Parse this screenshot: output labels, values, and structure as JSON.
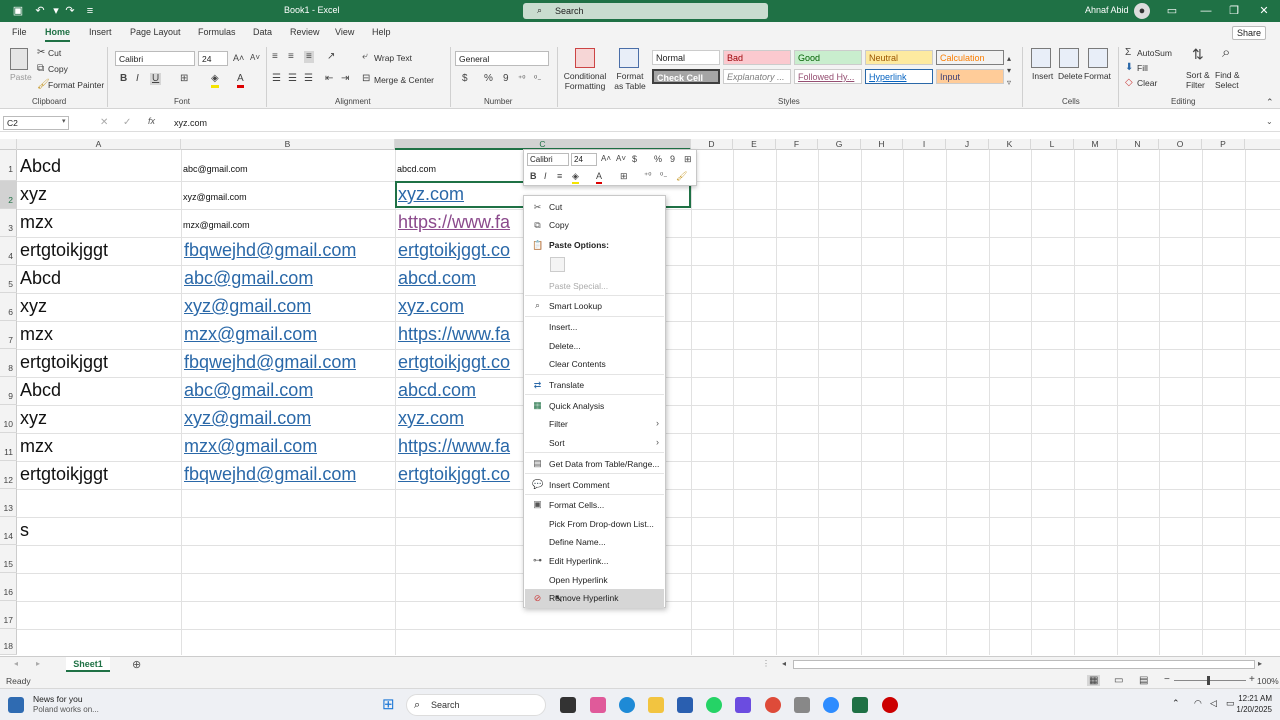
{
  "titlebar": {
    "doc_title": "Book1 - Excel",
    "search": "Search",
    "user": "Ahnaf Abid"
  },
  "tabs": [
    "File",
    "Home",
    "Insert",
    "Page Layout",
    "Formulas",
    "Data",
    "Review",
    "View",
    "Help"
  ],
  "share": "Share",
  "ribbon": {
    "clipboard": {
      "paste": "Paste",
      "cut": "Cut",
      "copy": "Copy",
      "format_painter": "Format Painter",
      "label": "Clipboard"
    },
    "font": {
      "name": "Calibri",
      "size": "24",
      "label": "Font",
      "bold": "B",
      "italic": "I",
      "underline": "U"
    },
    "alignment": {
      "wrap": "Wrap Text",
      "merge": "Merge & Center",
      "label": "Alignment"
    },
    "number": {
      "format": "General",
      "label": "Number",
      "currency": "$",
      "percent": "%",
      "comma": "9"
    },
    "styles": {
      "cond": "Conditional Formatting",
      "fmt_table": "Format as Table",
      "label": "Styles",
      "cells": [
        "Normal",
        "Bad",
        "Good",
        "Neutral",
        "Calculation",
        "Check Cell",
        "Explanatory ...",
        "Followed Hy...",
        "Hyperlink",
        "Input"
      ]
    },
    "cells": {
      "insert": "Insert",
      "delete": "Delete",
      "format": "Format",
      "label": "Cells"
    },
    "editing": {
      "autosum": "AutoSum",
      "fill": "Fill",
      "clear": "Clear",
      "sort": "Sort & Filter",
      "find": "Find & Select",
      "label": "Editing"
    }
  },
  "formula_bar": {
    "name_box": "C2",
    "fx": "fx",
    "content": "xyz.com"
  },
  "columns": [
    "A",
    "B",
    "C",
    "D",
    "E",
    "F",
    "G",
    "H",
    "I",
    "J",
    "K",
    "L",
    "M",
    "N",
    "O",
    "P"
  ],
  "rows": [
    "1",
    "2",
    "3",
    "4",
    "5",
    "6",
    "7",
    "8",
    "9",
    "10",
    "11",
    "12",
    "13",
    "14",
    "15",
    "16",
    "17",
    "18"
  ],
  "cells": {
    "r1": {
      "a": "Abcd",
      "b": "abc@gmail.com",
      "c": "abcd.com"
    },
    "r2": {
      "a": "xyz",
      "b": "xyz@gmail.com",
      "c": "xyz.com"
    },
    "r3": {
      "a": "mzx",
      "b": "mzx@gmail.com",
      "c": "https://www.fa"
    },
    "r4": {
      "a": "ertgtoikjggt",
      "b": "fbqwejhd@gmail.com",
      "c": "ertgtoikjggt.co"
    },
    "r5": {
      "a": "Abcd",
      "b": "abc@gmail.com",
      "c": "abcd.com"
    },
    "r6": {
      "a": "xyz",
      "b": "xyz@gmail.com",
      "c": "xyz.com"
    },
    "r7": {
      "a": "mzx",
      "b": "mzx@gmail.com",
      "c": "https://www.fa"
    },
    "r8": {
      "a": "ertgtoikjggt",
      "b": "fbqwejhd@gmail.com",
      "c": "ertgtoikjggt.co"
    },
    "r9": {
      "a": "Abcd",
      "b": "abc@gmail.com",
      "c": "abcd.com"
    },
    "r10": {
      "a": "xyz",
      "b": "xyz@gmail.com",
      "c": "xyz.com"
    },
    "r11": {
      "a": "mzx",
      "b": "mzx@gmail.com",
      "c": "https://www.fa"
    },
    "r12": {
      "a": "ertgtoikjggt",
      "b": "fbqwejhd@gmail.com",
      "c": "ertgtoikjggt.co"
    },
    "r14": {
      "a": "s"
    }
  },
  "mini_toolbar": {
    "font": "Calibri",
    "size": "24"
  },
  "context_menu": {
    "cut": "Cut",
    "copy": "Copy",
    "paste_options": "Paste Options:",
    "paste_special": "Paste Special...",
    "smart_lookup": "Smart Lookup",
    "insert": "Insert...",
    "delete": "Delete...",
    "clear": "Clear Contents",
    "translate": "Translate",
    "quick_analysis": "Quick Analysis",
    "filter": "Filter",
    "sort": "Sort",
    "get_data": "Get Data from Table/Range...",
    "insert_comment": "Insert Comment",
    "format_cells": "Format Cells...",
    "pick_list": "Pick From Drop-down List...",
    "define_name": "Define Name...",
    "edit_link": "Edit Hyperlink...",
    "open_link": "Open Hyperlink",
    "remove_link": "Remove Hyperlink"
  },
  "sheet_tab": "Sheet1",
  "status": {
    "ready": "Ready",
    "zoom": "100%"
  },
  "taskbar": {
    "news_title": "News for you",
    "news_sub": "Poland works on...",
    "search": "Search",
    "time": "12:21 AM",
    "date": "1/20/2025"
  },
  "colors": {
    "excel_green": "#1f7145",
    "link": "#2a68a8",
    "visited": "#8b4a8c"
  }
}
